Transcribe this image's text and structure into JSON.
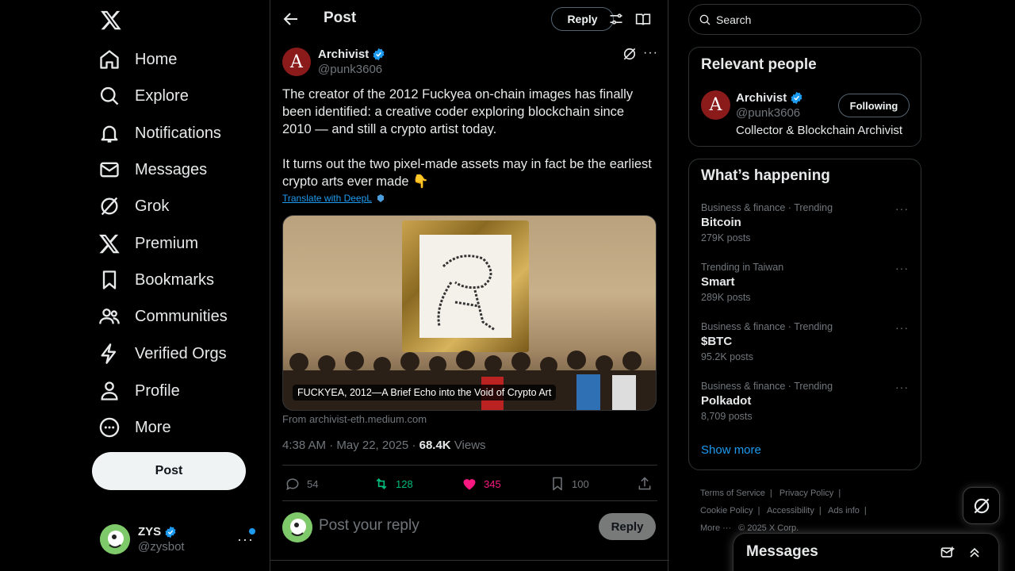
{
  "nav": {
    "items": [
      {
        "label": "Home",
        "icon": "home-icon"
      },
      {
        "label": "Explore",
        "icon": "search-icon"
      },
      {
        "label": "Notifications",
        "icon": "bell-icon"
      },
      {
        "label": "Messages",
        "icon": "mail-icon"
      },
      {
        "label": "Grok",
        "icon": "grok-icon"
      },
      {
        "label": "Premium",
        "icon": "x-logo-icon"
      },
      {
        "label": "Bookmarks",
        "icon": "bookmark-icon"
      },
      {
        "label": "Communities",
        "icon": "people-icon"
      },
      {
        "label": "Verified Orgs",
        "icon": "lightning-icon"
      },
      {
        "label": "Profile",
        "icon": "person-icon"
      },
      {
        "label": "More",
        "icon": "more-circle-icon"
      }
    ],
    "post_label": "Post"
  },
  "account": {
    "name": "ZYS",
    "handle": "@zysbot"
  },
  "header": {
    "title": "Post",
    "reply_label": "Reply"
  },
  "post": {
    "author_initial": "A",
    "author_name": "Archivist",
    "author_handle": "@punk3606",
    "text_p1": "The creator of the 2012 Fuckyea on-chain images has finally been identified: a creative coder exploring blockchain since 2010 — and still a crypto artist today.",
    "text_p2": "It turns out the two pixel-made assets may in fact be the earliest crypto arts ever made 👇",
    "translate_label": "Translate with DeepL",
    "media_caption": "FUCKYEA, 2012—A Brief Echo into the Void of Crypto Art",
    "media_source": "From archivist-eth.medium.com",
    "time": "4:38 AM · May 22, 2025",
    "views_count": "68.4K",
    "views_label": "Views",
    "replies": "54",
    "reposts": "128",
    "likes": "345",
    "bookmarks": "100"
  },
  "reply_box": {
    "placeholder": "Post your reply",
    "button": "Reply"
  },
  "search": {
    "placeholder": "Search"
  },
  "relevant_people": {
    "title": "Relevant people",
    "person": {
      "initial": "A",
      "name": "Archivist",
      "handle": "@punk3606",
      "bio": "Collector & Blockchain Archivist",
      "follow_label": "Following"
    }
  },
  "trends": {
    "title": "What’s happening",
    "items": [
      {
        "category": "Business & finance · Trending",
        "title": "Bitcoin",
        "count": "279K posts"
      },
      {
        "category": "Trending in Taiwan",
        "title": "Smart",
        "count": "289K posts"
      },
      {
        "category": "Business & finance · Trending",
        "title": "$BTC",
        "count": "95.2K posts"
      },
      {
        "category": "Business & finance · Trending",
        "title": "Polkadot",
        "count": "8,709 posts"
      }
    ],
    "show_more": "Show more"
  },
  "footer": {
    "terms": "Terms of Service",
    "privacy": "Privacy Policy",
    "cookie": "Cookie Policy",
    "accessibility": "Accessibility",
    "ads": "Ads info",
    "more": "More ···",
    "copyright": "© 2025 X Corp."
  },
  "messages_drawer": {
    "title": "Messages"
  },
  "colors": {
    "accent": "#1d9bf0",
    "like": "#f91880",
    "repost": "#00ba7c",
    "background": "#000000"
  }
}
